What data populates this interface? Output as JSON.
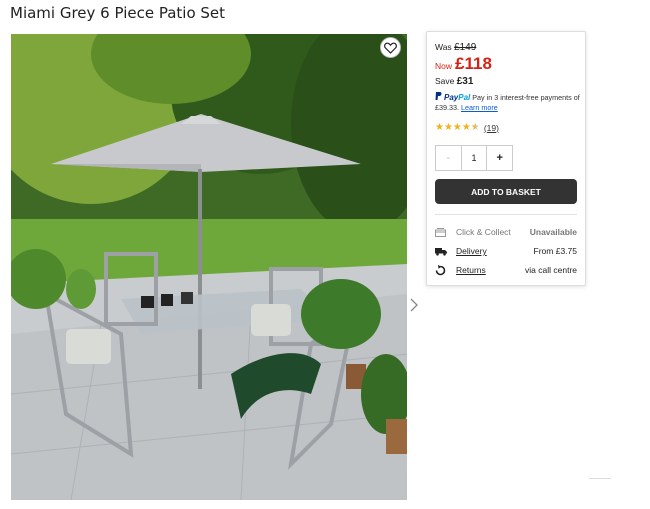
{
  "product": {
    "title": "Miami Grey 6 Piece Patio Set"
  },
  "pricing": {
    "was_label": "Was",
    "was_price": "£149",
    "now_label": "Now",
    "now_price": "£118",
    "save_label": "Save",
    "save_amount": "£31",
    "sale_color": "#d42114"
  },
  "paypal": {
    "logo_pay": "Pay",
    "logo_pal": "Pal",
    "message": "Pay in 3 interest-free payments of £39.33.",
    "learn_more": "Learn more"
  },
  "rating": {
    "stars": 4.5,
    "count_text": "(19)"
  },
  "quantity": {
    "minus": "-",
    "value": "1",
    "plus": "+"
  },
  "basket_button": "ADD TO BASKET",
  "fulfilment": [
    {
      "icon": "store-icon",
      "label": "Click & Collect",
      "value": "Unavailable"
    },
    {
      "icon": "truck-icon",
      "label": "Delivery",
      "value": "From £3.75"
    },
    {
      "icon": "return-icon",
      "label": "Returns",
      "value": "via call centre"
    }
  ]
}
